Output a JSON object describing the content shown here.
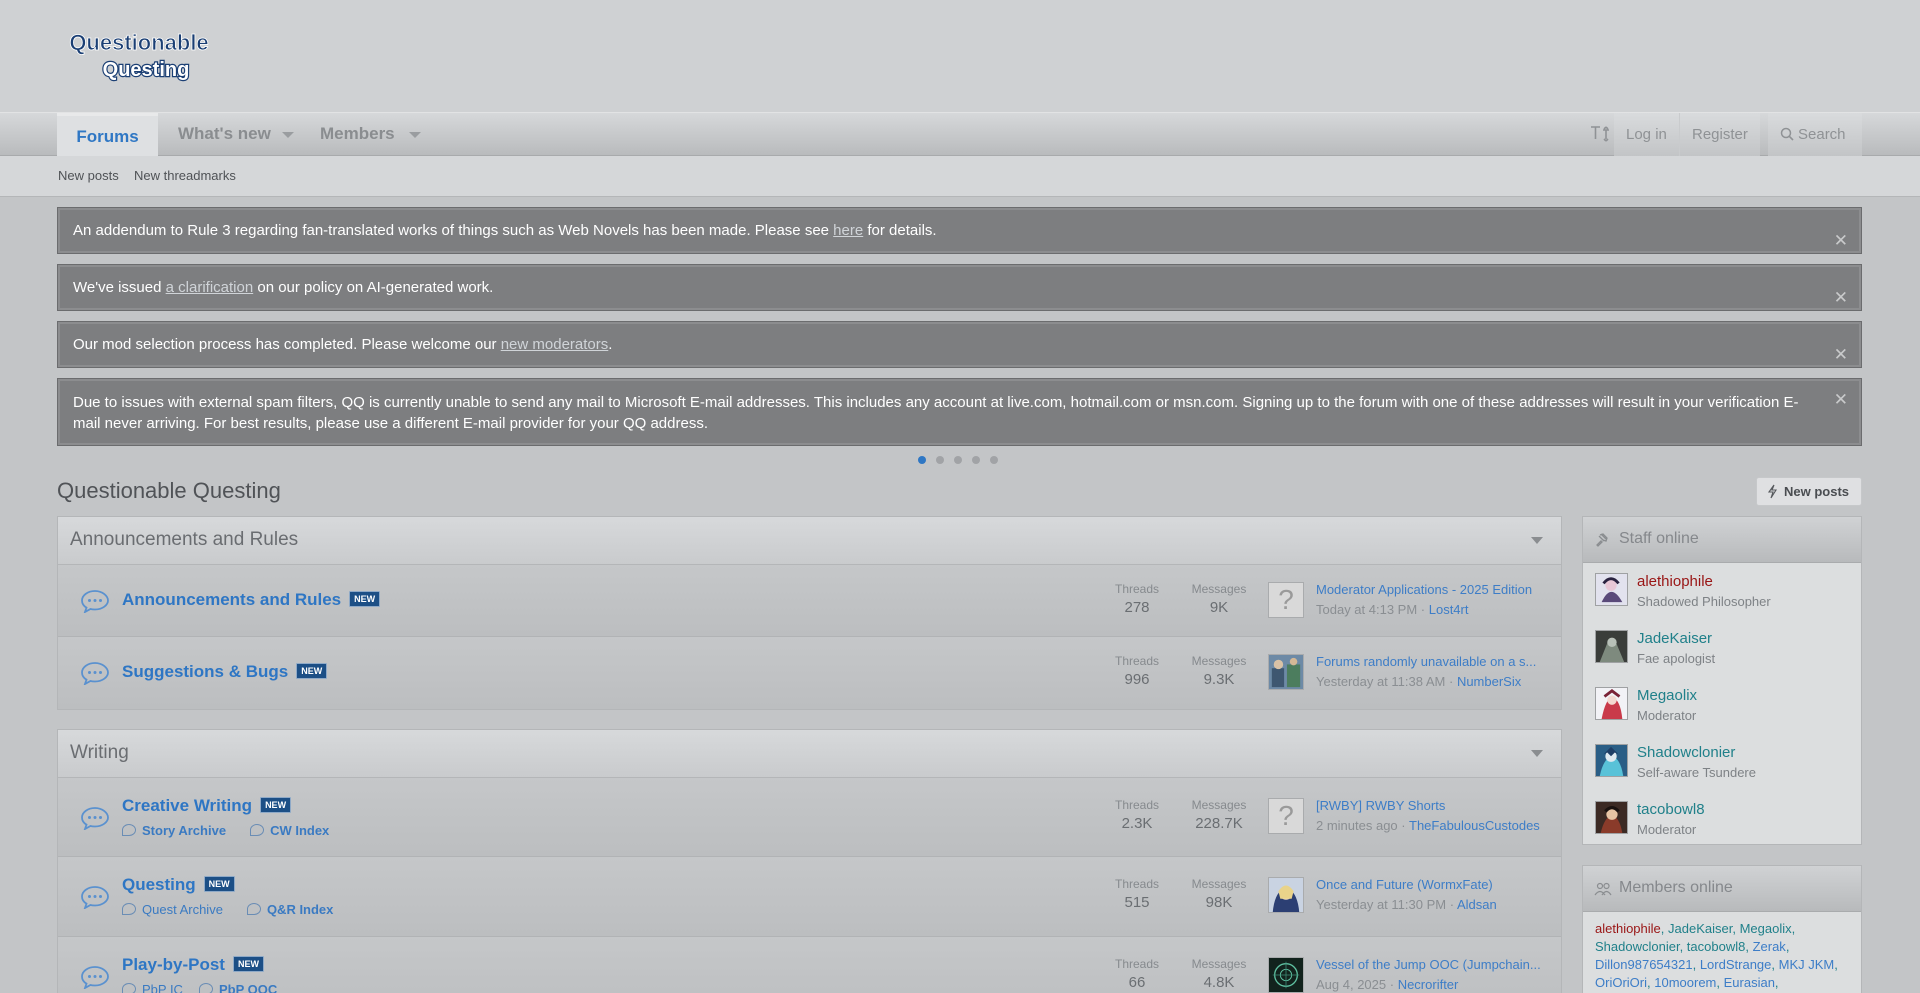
{
  "header": {
    "logo_text_1": "Questionable",
    "logo_text_2": "Questing"
  },
  "nav": {
    "tabs": [
      {
        "label": "Forums"
      },
      {
        "label": "What's new"
      },
      {
        "label": "Members"
      }
    ],
    "text_size_icon": "text-size-icon",
    "login_label": "Log in",
    "register_label": "Register",
    "search_label": "Search"
  },
  "subnav": {
    "items": [
      "New posts",
      "New threadmarks"
    ]
  },
  "notices": [
    {
      "pre": "An addendum to Rule 3 regarding fan-translated works of things such as Web Novels has been made. Please see ",
      "link": "here",
      "post": " for details."
    },
    {
      "pre": "We've issued ",
      "link": "a clarification",
      "post": " on our policy on AI-generated work."
    },
    {
      "pre": "Our mod selection process has completed. Please welcome our ",
      "link": "new moderators",
      "post": "."
    },
    {
      "pre": "Due to issues with external spam filters, QQ is currently unable to send any mail to Microsoft E-mail addresses. This includes any account at live.com, hotmail.com or msn.com. Signing up to the forum with one of these addresses will result in your verification E-mail never arriving. For best results, please use a different E-mail provider for your QQ address.",
      "link": "",
      "post": ""
    }
  ],
  "close_glyph": "✕",
  "page_title": "Questionable Questing",
  "new_posts_button": "New posts",
  "stat_labels": {
    "threads": "Threads",
    "messages": "Messages"
  },
  "badge_text": "NEW",
  "categories": [
    {
      "title": "Announcements and Rules",
      "forums": [
        {
          "name": "Announcements and Rules",
          "threads": "278",
          "messages": "9K",
          "last_title": "Moderator Applications - 2025 Edition",
          "last_time": "Today at 4:13 PM",
          "last_user": "Lost4rt"
        },
        {
          "name": "Suggestions & Bugs",
          "threads": "996",
          "messages": "9.3K",
          "last_title": "Forums randomly unavailable on a s...",
          "last_time": "Yesterday at 11:38 AM",
          "last_user": "NumberSix"
        }
      ]
    },
    {
      "title": "Writing",
      "forums": [
        {
          "name": "Creative Writing",
          "sub1": "Story Archive",
          "sub2": "CW Index",
          "threads": "2.3K",
          "messages": "228.7K",
          "last_title": "[RWBY] RWBY Shorts",
          "last_time": "2 minutes ago",
          "last_user": "TheFabulousCustodes"
        },
        {
          "name": "Questing",
          "sub1": "Quest Archive",
          "sub2": "Q&R Index",
          "threads": "515",
          "messages": "98K",
          "last_title": "Once and Future (WormxFate)",
          "last_time": "Yesterday at 11:30 PM",
          "last_user": "Aldsan"
        },
        {
          "name": "Play-by-Post",
          "sub1": "PbP IC",
          "sub2": "PbP OOC",
          "threads": "66",
          "messages": "4.8K",
          "last_title": "Vessel of the Jump OOC (Jumpchain...",
          "last_time": "Aug 4, 2025",
          "last_user": "Necrorifter"
        }
      ]
    }
  ],
  "staff_online": {
    "title": "Staff online",
    "members": [
      {
        "name": "alethiophile",
        "role": "Shadowed Philosopher"
      },
      {
        "name": "JadeKaiser",
        "role": "Fae apologist"
      },
      {
        "name": "Megaolix",
        "role": "Moderator"
      },
      {
        "name": "Shadowclonier",
        "role": "Self-aware Tsundere"
      },
      {
        "name": "tacobowl8",
        "role": "Moderator"
      }
    ]
  },
  "members_online": {
    "title": "Members online",
    "names": [
      "alethiophile",
      "JadeKaiser",
      "Megaolix",
      "Shadowclonier",
      "tacobowl8",
      "Zerak",
      "Dillon987654321",
      "LordStrange",
      "MKJ JKM",
      "OriOriOri",
      "10moorem",
      "Eurasian"
    ]
  },
  "colors": {
    "accent": "#2f77c4",
    "notice_bg": "#7d7e80",
    "admin_name": "#991515",
    "staff_name": "#20808a"
  }
}
